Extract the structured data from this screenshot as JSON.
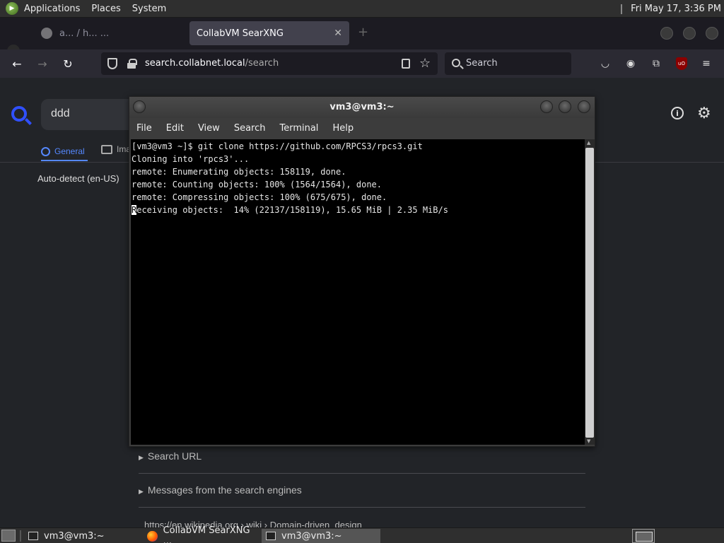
{
  "top_panel": {
    "menus": [
      "Applications",
      "Places",
      "System"
    ],
    "clock": "Fri May 17,  3:36 PM"
  },
  "browser": {
    "tabs": [
      {
        "title": "a... / h... ...",
        "active": false
      },
      {
        "title": "CollabVM SearXNG",
        "active": true
      }
    ],
    "url_host": "search.collabnet.local",
    "url_path": "/search",
    "search_placeholder": "Search"
  },
  "searxng": {
    "query": "ddd",
    "tabs": {
      "general": "General",
      "images": "Ima"
    },
    "language": "Auto-detect (en-US)",
    "sections": [
      "Search URL",
      "Messages from the search engines"
    ],
    "truncated_result": "https://en.wikipedia.org › wiki › Domain-driven_design",
    "accent": "#3050ff"
  },
  "terminal": {
    "title": "vm3@vm3:~",
    "menu": [
      "File",
      "Edit",
      "View",
      "Search",
      "Terminal",
      "Help"
    ],
    "lines": [
      "[vm3@vm3 ~]$ git clone https://github.com/RPCS3/rpcs3.git",
      "Cloning into 'rpcs3'...",
      "remote: Enumerating objects: 158119, done.",
      "remote: Counting objects: 100% (1564/1564), done.",
      "remote: Compressing objects: 100% (675/675), done.",
      "Receiving objects:  14% (22137/158119), 15.65 MiB | 2.35 MiB/s"
    ]
  },
  "taskbar": {
    "tasks": [
      {
        "label": "vm3@vm3:~",
        "icon": "terminal-icon",
        "active": false
      },
      {
        "label": "CollabVM SearXNG ...",
        "icon": "firefox-icon",
        "active": false
      },
      {
        "label": "vm3@vm3:~",
        "icon": "terminal-icon",
        "active": true
      }
    ]
  }
}
